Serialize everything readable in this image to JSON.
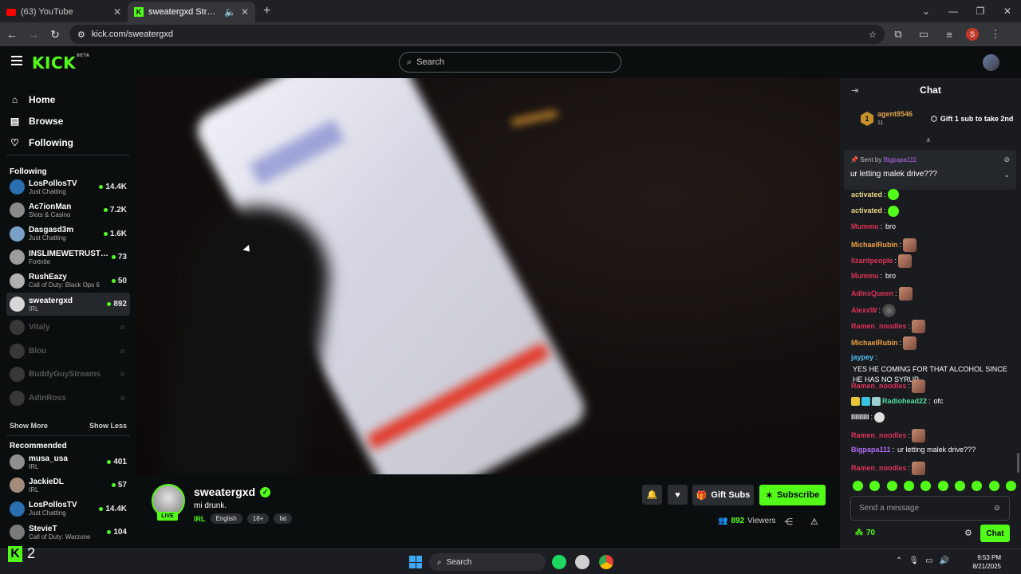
{
  "browser": {
    "tabs": [
      {
        "label": "(63) YouTube",
        "icon": "youtube-icon",
        "active": false
      },
      {
        "label": "sweatergxd Stream - Watch",
        "icon": "kick-icon",
        "active": true
      }
    ],
    "url": "kick.com/sweatergxd",
    "profile_initial": "S"
  },
  "header": {
    "logo": "KICK",
    "logo_beta": "BETA",
    "search_placeholder": "Search"
  },
  "sidebar": {
    "nav": [
      {
        "label": "Home",
        "icon": "home-icon"
      },
      {
        "label": "Browse",
        "icon": "browse-icon"
      },
      {
        "label": "Following",
        "icon": "heart-icon"
      }
    ],
    "following_title": "Following",
    "following": [
      {
        "name": "LosPollosTV",
        "category": "Just Chatting",
        "viewers": "14.4K",
        "live": true,
        "color": "#2a6fb0"
      },
      {
        "name": "Ac7ionMan",
        "category": "Slots & Casino",
        "viewers": "7.2K",
        "live": true,
        "color": "#8a8a8a"
      },
      {
        "name": "Dasgasd3m",
        "category": "Just Chatting",
        "viewers": "1.6K",
        "live": true,
        "color": "#7aa0c8"
      },
      {
        "name": "INSLIMEWETRUSTL...",
        "category": "Fortnite",
        "viewers": "73",
        "live": true,
        "color": "#9c9c9c"
      },
      {
        "name": "RushEazy",
        "category": "Call of Duty: Black Ops 6",
        "viewers": "50",
        "live": true,
        "color": "#b0b0b0"
      },
      {
        "name": "sweatergxd",
        "category": "IRL",
        "viewers": "892",
        "live": true,
        "color": "#d8d8d8"
      },
      {
        "name": "Vitaly",
        "category": "",
        "viewers": "",
        "live": false,
        "color": "#888888"
      },
      {
        "name": "Blou",
        "category": "",
        "viewers": "",
        "live": false,
        "color": "#888888"
      },
      {
        "name": "BuddyGuyStreams",
        "category": "",
        "viewers": "",
        "live": false,
        "color": "#888888"
      },
      {
        "name": "AdinRoss",
        "category": "",
        "viewers": "",
        "live": false,
        "color": "#888888"
      }
    ],
    "show_more": "Show More",
    "show_less": "Show Less",
    "recommended_title": "Recommended",
    "recommended": [
      {
        "name": "musa_usa",
        "category": "IRL",
        "viewers": "401",
        "color": "#8f8f8f"
      },
      {
        "name": "JackieDL",
        "category": "IRL",
        "viewers": "57",
        "color": "#a48a7a"
      },
      {
        "name": "LosPollosTV",
        "category": "Just Chatting",
        "viewers": "14.4K",
        "color": "#2a6fb0"
      },
      {
        "name": "StevieT",
        "category": "Call of Duty: Warzone",
        "viewers": "104",
        "color": "#7a7a7a"
      }
    ]
  },
  "stream": {
    "channel": "sweatergxd",
    "title": "mi drunk.",
    "live_label": "LIVE",
    "category": "IRL",
    "tags": [
      "English",
      "18+",
      "fat"
    ],
    "gift_label": "Gift Subs",
    "subscribe_label": "Subscribe",
    "viewers": "892",
    "viewers_label": "Viewers"
  },
  "chat": {
    "title": "Chat",
    "leader": {
      "rank": "1",
      "user": "agent8546",
      "count": "11"
    },
    "gift_cta": "Gift 1 sub to take 2nd",
    "pinned": {
      "sent_by_label": "Sent by",
      "sent_by": "Bigpapa111",
      "message": "ur letting malek drive???"
    },
    "messages": [
      {
        "user": "activated",
        "color": "#e8d48a",
        "text": "",
        "emote": "kick"
      },
      {
        "user": "activated",
        "color": "#e8d48a",
        "text": "",
        "emote": "kick"
      },
      {
        "user": "Mummu",
        "color": "#e0325a",
        "text": "bro",
        "emote": ""
      },
      {
        "user": "MichaelRubin",
        "color": "#f0a040",
        "text": "",
        "emote": "face"
      },
      {
        "user": "lizardpeople",
        "color": "#e0325a",
        "text": "",
        "emote": "face"
      },
      {
        "user": "Mummu",
        "color": "#e0325a",
        "text": "bro",
        "emote": ""
      },
      {
        "user": "AdinsQueen",
        "color": "#e0325a",
        "text": "",
        "emote": "face"
      },
      {
        "user": "AlexxW",
        "color": "#e0325a",
        "text": "",
        "emote": "dark"
      },
      {
        "user": "Ramen_noodles",
        "color": "#e0325a",
        "text": "",
        "emote": "face"
      },
      {
        "user": "MichaelRubin",
        "color": "#f0a040",
        "text": "",
        "emote": "face"
      },
      {
        "user": "jaypey",
        "color": "#4fc3f7",
        "text": "YES HE COMING FOR THAT ALCOHOL SINCE HE HAS NO SYRUP",
        "emote": ""
      },
      {
        "user": "Ramen_noodles",
        "color": "#e0325a",
        "text": "",
        "emote": "face"
      },
      {
        "user": "Radiohead22",
        "color": "#53e0a0",
        "text": "ofc",
        "emote": "",
        "badges": true
      },
      {
        "user": "IIIIIIIII",
        "color": "#ffffff",
        "text": "",
        "emote": "cake"
      },
      {
        "user": "Ramen_noodles",
        "color": "#e0325a",
        "text": "",
        "emote": "face"
      },
      {
        "user": "Bigpapa111",
        "color": "#b26cf3",
        "text": "ur letting malek drive???",
        "emote": ""
      },
      {
        "user": "Ramen_noodles",
        "color": "#e0325a",
        "text": "",
        "emote": "face"
      }
    ],
    "input_placeholder": "Send a message",
    "points": "70",
    "send_label": "Chat"
  },
  "taskbar": {
    "kick_count": "2",
    "search_label": "Search",
    "time": "9:53 PM",
    "date": "8/21/2025"
  }
}
